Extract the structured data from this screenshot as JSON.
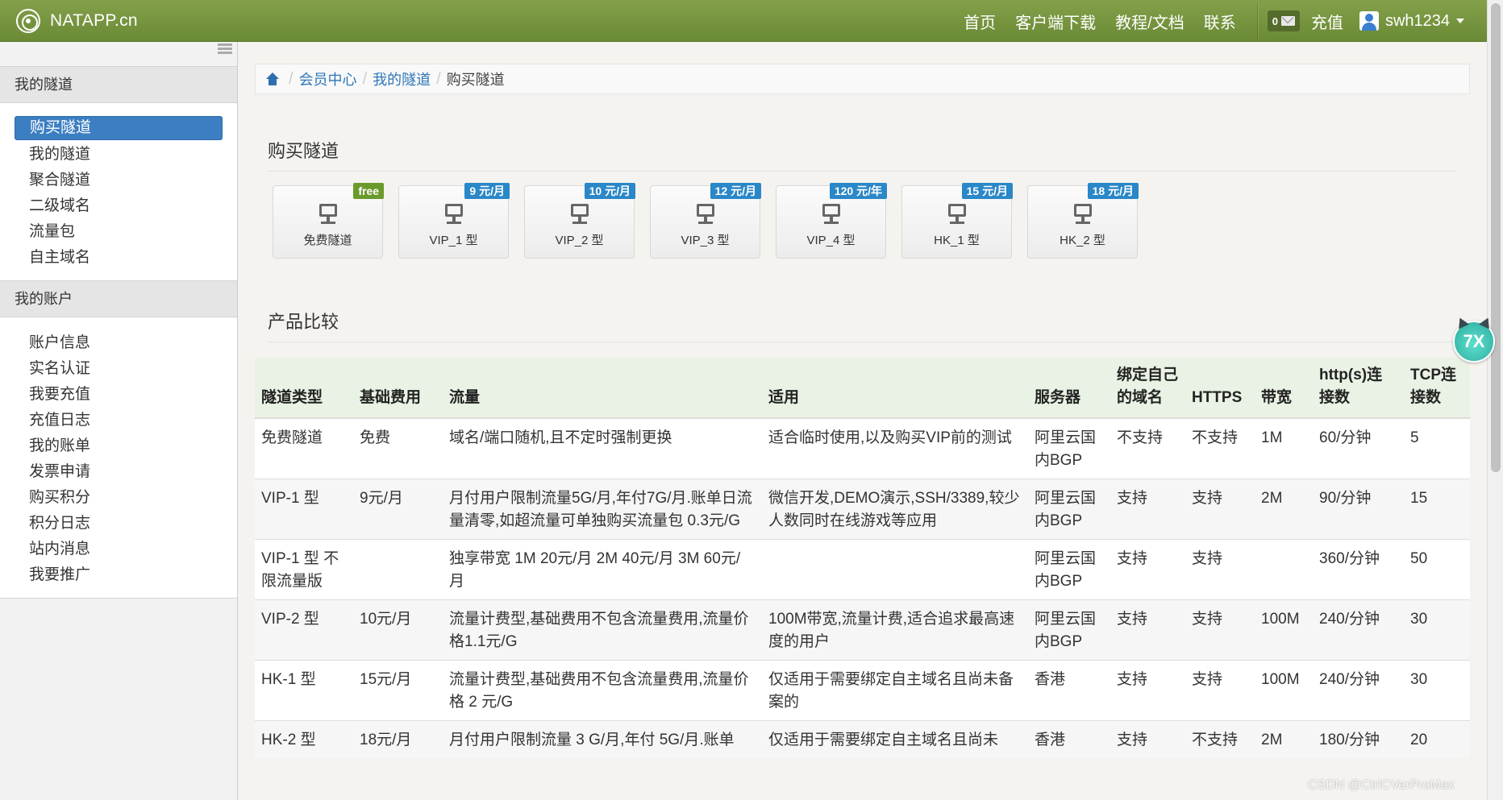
{
  "navbar": {
    "brand": "NATAPP.cn",
    "links": [
      "首页",
      "客户端下载",
      "教程/文档",
      "联系"
    ],
    "message_count": "0",
    "recharge": "充值",
    "username": "swh1234"
  },
  "sidebar": {
    "tunnels_title": "我的隧道",
    "tunnel_items": [
      "购买隧道",
      "我的隧道",
      "聚合隧道",
      "二级域名",
      "流量包",
      "自主域名"
    ],
    "account_title": "我的账户",
    "account_items": [
      "账户信息",
      "实名认证",
      "我要充值",
      "充值日志",
      "我的账单",
      "发票申请",
      "购买积分",
      "积分日志",
      "站内消息",
      "我要推广"
    ]
  },
  "breadcrumb": [
    "会员中心",
    "我的隧道",
    "购买隧道"
  ],
  "buy_section_title": "购买隧道",
  "plans": [
    {
      "label": "免费隧道",
      "badge": "free",
      "badge_color": "#6b9a2c"
    },
    {
      "label": "VIP_1 型",
      "badge": "9 元/月",
      "badge_color": "#2a87c8"
    },
    {
      "label": "VIP_2 型",
      "badge": "10 元/月",
      "badge_color": "#2a87c8"
    },
    {
      "label": "VIP_3 型",
      "badge": "12 元/月",
      "badge_color": "#2a87c8"
    },
    {
      "label": "VIP_4 型",
      "badge": "120 元/年",
      "badge_color": "#2a87c8"
    },
    {
      "label": "HK_1 型",
      "badge": "15 元/月",
      "badge_color": "#2a87c8"
    },
    {
      "label": "HK_2 型",
      "badge": "18 元/月",
      "badge_color": "#2a87c8"
    }
  ],
  "compare_section_title": "产品比较",
  "table": {
    "headers": [
      "隧道类型",
      "基础费用",
      "流量",
      "适用",
      "服务器",
      "绑定自己的域名",
      "HTTPS",
      "带宽",
      "http(s)连接数",
      "TCP连接数"
    ],
    "rows": [
      [
        "免费隧道",
        "免费",
        "域名/端口随机,且不定时强制更换",
        "适合临时使用,以及购买VIP前的测试",
        "阿里云国内BGP",
        "不支持",
        "不支持",
        "1M",
        "60/分钟",
        "5"
      ],
      [
        "VIP-1 型",
        "9元/月",
        "月付用户限制流量5G/月,年付7G/月.账单日流量清零,如超流量可单独购买流量包 0.3元/G",
        "微信开发,DEMO演示,SSH/3389,较少人数同时在线游戏等应用",
        "阿里云国内BGP",
        "支持",
        "支持",
        "2M",
        "90/分钟",
        "15"
      ],
      [
        "VIP-1 型 不限流量版",
        "",
        "独享带宽 1M 20元/月 2M 40元/月 3M 60元/月",
        "",
        "阿里云国内BGP",
        "支持",
        "支持",
        "",
        "360/分钟",
        "50"
      ],
      [
        "VIP-2 型",
        "10元/月",
        "流量计费型,基础费用不包含流量费用,流量价格1.1元/G",
        "100M带宽,流量计费,适合追求最高速度的用户",
        "阿里云国内BGP",
        "支持",
        "支持",
        "100M",
        "240/分钟",
        "30"
      ],
      [
        "HK-1 型",
        "15元/月",
        "流量计费型,基础费用不包含流量费用,流量价格 2 元/G",
        "仅适用于需要绑定自主域名且尚未备案的",
        "香港",
        "支持",
        "支持",
        "100M",
        "240/分钟",
        "30"
      ],
      [
        "HK-2 型",
        "18元/月",
        "月付用户限制流量 3 G/月,年付 5G/月.账单",
        "仅适用于需要绑定自主域名且尚未",
        "香港",
        "支持",
        "不支持",
        "2M",
        "180/分钟",
        "20"
      ]
    ]
  },
  "mascot_text": "7X",
  "watermark": "CSDN @CtrlCVerProMax"
}
